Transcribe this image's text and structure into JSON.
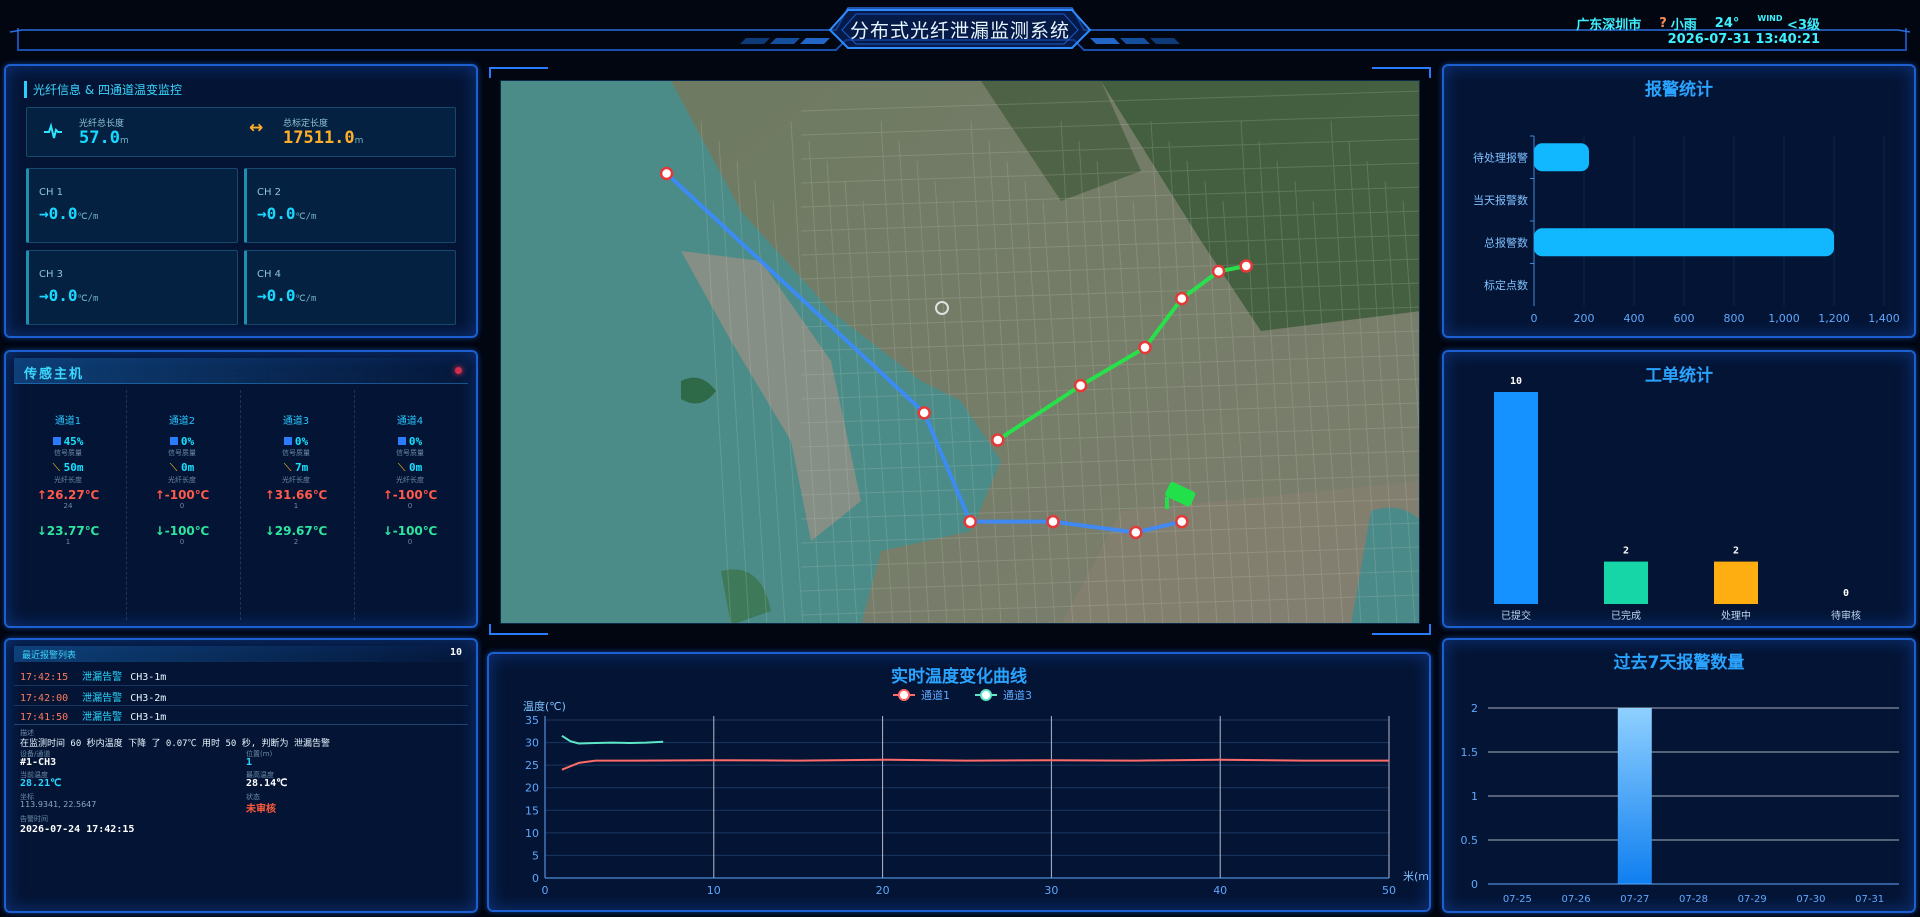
{
  "header": {
    "title": "分布式光纤泄漏监测系统",
    "city": "广东深圳市",
    "weather_icon": "rain-icon",
    "weather": "小雨",
    "temperature": "24°",
    "wind_label": "WIND",
    "wind_value": "<3级",
    "datetime": "2026-07-31 13:40:21"
  },
  "fiber": {
    "section_title": "光纤信息 & 四通道温变监控",
    "total_length_label": "光纤总长度",
    "total_length_value": "57.0",
    "total_length_unit": "m",
    "calibrated_length_label": "总标定长度",
    "calibrated_length_value": "17511.0",
    "calibrated_length_unit": "m",
    "channels": [
      {
        "name": "CH 1",
        "value": "→0.0",
        "unit": "℃/m"
      },
      {
        "name": "CH 2",
        "value": "→0.0",
        "unit": "℃/m"
      },
      {
        "name": "CH 3",
        "value": "→0.0",
        "unit": "℃/m"
      },
      {
        "name": "CH 4",
        "value": "→0.0",
        "unit": "℃/m"
      }
    ]
  },
  "host": {
    "title": "传感主机",
    "channels": [
      {
        "name": "通道1",
        "signal": "45%",
        "signal_label": "信号质量",
        "length": "50m",
        "length_label": "光纤长度",
        "max": "↑26.27℃",
        "max_pos": "24",
        "min": "↓23.77℃",
        "min_pos": "1"
      },
      {
        "name": "通道2",
        "signal": "0%",
        "signal_label": "信号质量",
        "length": "0m",
        "length_label": "光纤长度",
        "max": "↑-100℃",
        "max_pos": "0",
        "min": "↓-100℃",
        "min_pos": "0"
      },
      {
        "name": "通道3",
        "signal": "0%",
        "signal_label": "信号质量",
        "length": "7m",
        "length_label": "光纤长度",
        "max": "↑31.66℃",
        "max_pos": "1",
        "min": "↓29.67℃",
        "min_pos": "2"
      },
      {
        "name": "通道4",
        "signal": "0%",
        "signal_label": "信号质量",
        "length": "0m",
        "length_label": "光纤长度",
        "max": "↑-100℃",
        "max_pos": "0",
        "min": "↓-100℃",
        "min_pos": "0"
      }
    ]
  },
  "alarms": {
    "title": "最近报警列表",
    "count": "10",
    "rows": [
      {
        "time": "17:42:15",
        "type": "泄漏告警",
        "loc": "CH3-1m"
      },
      {
        "time": "17:42:00",
        "type": "泄漏告警",
        "loc": "CH3-2m"
      },
      {
        "time": "17:41:50",
        "type": "泄漏告警",
        "loc": "CH3-1m"
      }
    ],
    "detail": {
      "desc_label": "描述",
      "desc": "在监测时间 60 秒内温度 下降 了 0.07℃ 用时 50 秒, 判断为 泄漏告警",
      "host_label": "设备/通道",
      "host": "#1-CH3",
      "pos_label": "位置(m)",
      "pos": "1",
      "cur_label": "当前温度",
      "cur": "28.21℃",
      "max_label": "最高温度",
      "max": "28.14℃",
      "coord_label": "坐标",
      "coord": "113.9341, 22.5647",
      "status_label": "状态",
      "status": "未审核",
      "time_label": "告警时间",
      "time": "2026-07-24 17:42:15"
    }
  },
  "alarm_stats": {
    "title": "报警统计",
    "chart_data": {
      "type": "bar",
      "orientation": "horizontal",
      "categories": [
        "待处理报警",
        "当天报警数",
        "总报警数",
        "标定点数"
      ],
      "values": [
        220,
        0,
        1200,
        0
      ],
      "xlim": [
        0,
        1400
      ],
      "xticks": [
        "0",
        "200",
        "400",
        "600",
        "800",
        "1,000",
        "1,200",
        "1,400"
      ]
    }
  },
  "work_stats": {
    "title": "工单统计",
    "chart_data": {
      "type": "bar",
      "categories": [
        "已提交",
        "已完成",
        "处理中",
        "待审核"
      ],
      "values": [
        10,
        2,
        2,
        0
      ],
      "colors": [
        "#1592ff",
        "#16d6a8",
        "#ffae12",
        "#888888"
      ]
    }
  },
  "week_stats": {
    "title": "过去7天报警数量",
    "chart_data": {
      "type": "bar",
      "categories": [
        "07-25",
        "07-26",
        "07-27",
        "07-28",
        "07-29",
        "07-30",
        "07-31"
      ],
      "values": [
        0,
        0,
        2,
        0,
        0,
        0,
        0
      ],
      "ylim": [
        0,
        2
      ],
      "yticks": [
        "0",
        "0.5",
        "1",
        "1.5",
        "2"
      ]
    }
  },
  "temp_chart": {
    "title": "实时温度变化曲线",
    "chart_data": {
      "type": "line",
      "ylabel": "温度(℃)",
      "xlabel": "米(m)",
      "xlim": [
        0,
        50
      ],
      "ylim": [
        0,
        35
      ],
      "xticks": [
        "0",
        "10",
        "20",
        "30",
        "40",
        "50"
      ],
      "yticks": [
        "0",
        "5",
        "10",
        "15",
        "20",
        "25",
        "30",
        "35"
      ],
      "series": [
        {
          "name": "通道1",
          "color": "#ff6b6b",
          "x": [
            1,
            2,
            3,
            5,
            10,
            15,
            20,
            25,
            30,
            35,
            40,
            45,
            50
          ],
          "y": [
            24,
            25.5,
            26,
            26,
            26.1,
            26,
            26.2,
            26,
            26.1,
            26,
            26.2,
            26,
            26
          ]
        },
        {
          "name": "通道3",
          "color": "#5ee6c8",
          "x": [
            1,
            1.5,
            2,
            3,
            4,
            5,
            6,
            7
          ],
          "y": [
            31.5,
            30.3,
            29.8,
            29.9,
            30,
            29.9,
            30,
            30.2
          ]
        }
      ]
    }
  },
  "map": {
    "markers_green": [
      [
        0.54,
        0.66
      ],
      [
        0.63,
        0.56
      ],
      [
        0.7,
        0.49
      ],
      [
        0.74,
        0.4
      ],
      [
        0.78,
        0.35
      ],
      [
        0.81,
        0.34
      ]
    ],
    "markers_blue": [
      [
        0.18,
        0.17
      ],
      [
        0.46,
        0.61
      ],
      [
        0.51,
        0.81
      ],
      [
        0.6,
        0.81
      ],
      [
        0.69,
        0.83
      ],
      [
        0.74,
        0.81
      ]
    ]
  }
}
